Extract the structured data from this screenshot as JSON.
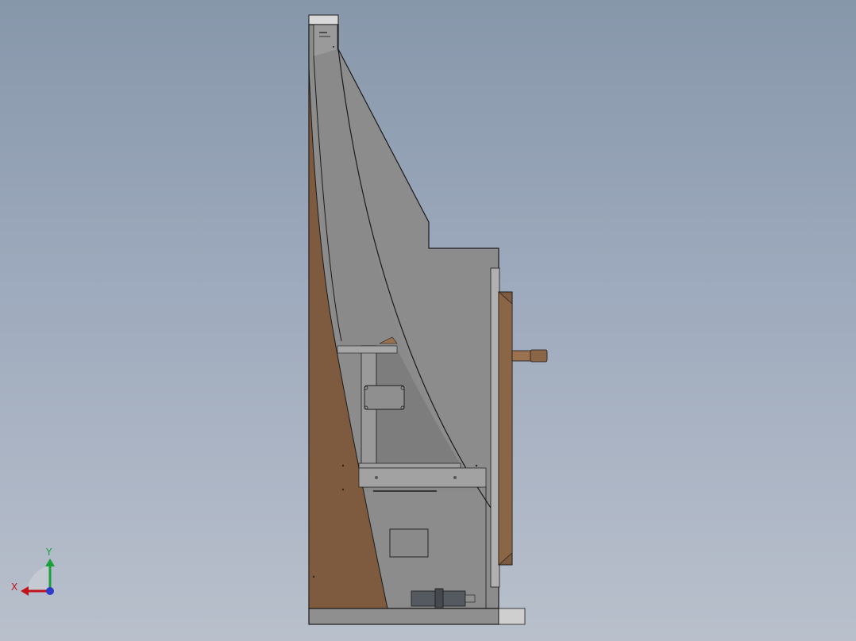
{
  "viewport": {
    "background_top": "#8797aa",
    "background_bottom": "#b9c0cc"
  },
  "model": {
    "colors": {
      "sheet_metal": "#8c8c8c",
      "sheet_metal_dark": "#7a7a7a",
      "sheet_metal_light": "#a8a8a8",
      "wood": "#7e5b3e",
      "wood_light": "#9a7250",
      "outline": "#1a1a1a"
    }
  },
  "triad": {
    "x_label": "X",
    "y_label": "Y",
    "x_color": "#c0141c",
    "y_color": "#1aa03a",
    "z_color": "#2a3cc8"
  }
}
